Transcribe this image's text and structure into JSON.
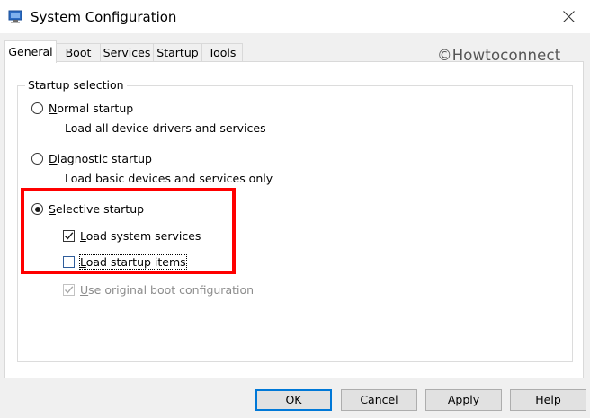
{
  "window": {
    "title": "System Configuration",
    "icons": {
      "app": "system-configuration-icon",
      "close": "close-icon"
    }
  },
  "tabs": [
    {
      "label": "General",
      "active": true
    },
    {
      "label": "Boot",
      "active": false
    },
    {
      "label": "Services",
      "active": false
    },
    {
      "label": "Startup",
      "active": false
    },
    {
      "label": "Tools",
      "active": false
    }
  ],
  "watermark": "©Howtoconnect",
  "startup_selection": {
    "legend": "Startup selection",
    "normal": {
      "accel": "N",
      "rest": "ormal startup",
      "description": "Load all device drivers and services",
      "selected": false
    },
    "diagnostic": {
      "accel": "D",
      "rest": "iagnostic startup",
      "description": "Load basic devices and services only",
      "selected": false
    },
    "selective": {
      "accel": "S",
      "rest": "elective startup",
      "selected": true,
      "options": {
        "load_system_services": {
          "accel": "L",
          "rest": "oad system services",
          "checked": true
        },
        "load_startup_items": {
          "accel": "L",
          "rest": "oad startup items",
          "checked": false
        },
        "use_original_boot": {
          "accel": "U",
          "rest": "se original boot configuration",
          "checked": true,
          "disabled": true
        }
      }
    }
  },
  "buttons": {
    "ok": "OK",
    "cancel": "Cancel",
    "apply": {
      "accel": "A",
      "rest": "pply"
    },
    "help": "Help"
  },
  "colors": {
    "highlight": "#ff0000",
    "default_button_border": "#0078d7",
    "titlebar": "#ffffff",
    "dialog_background": "#f0f0f0"
  }
}
